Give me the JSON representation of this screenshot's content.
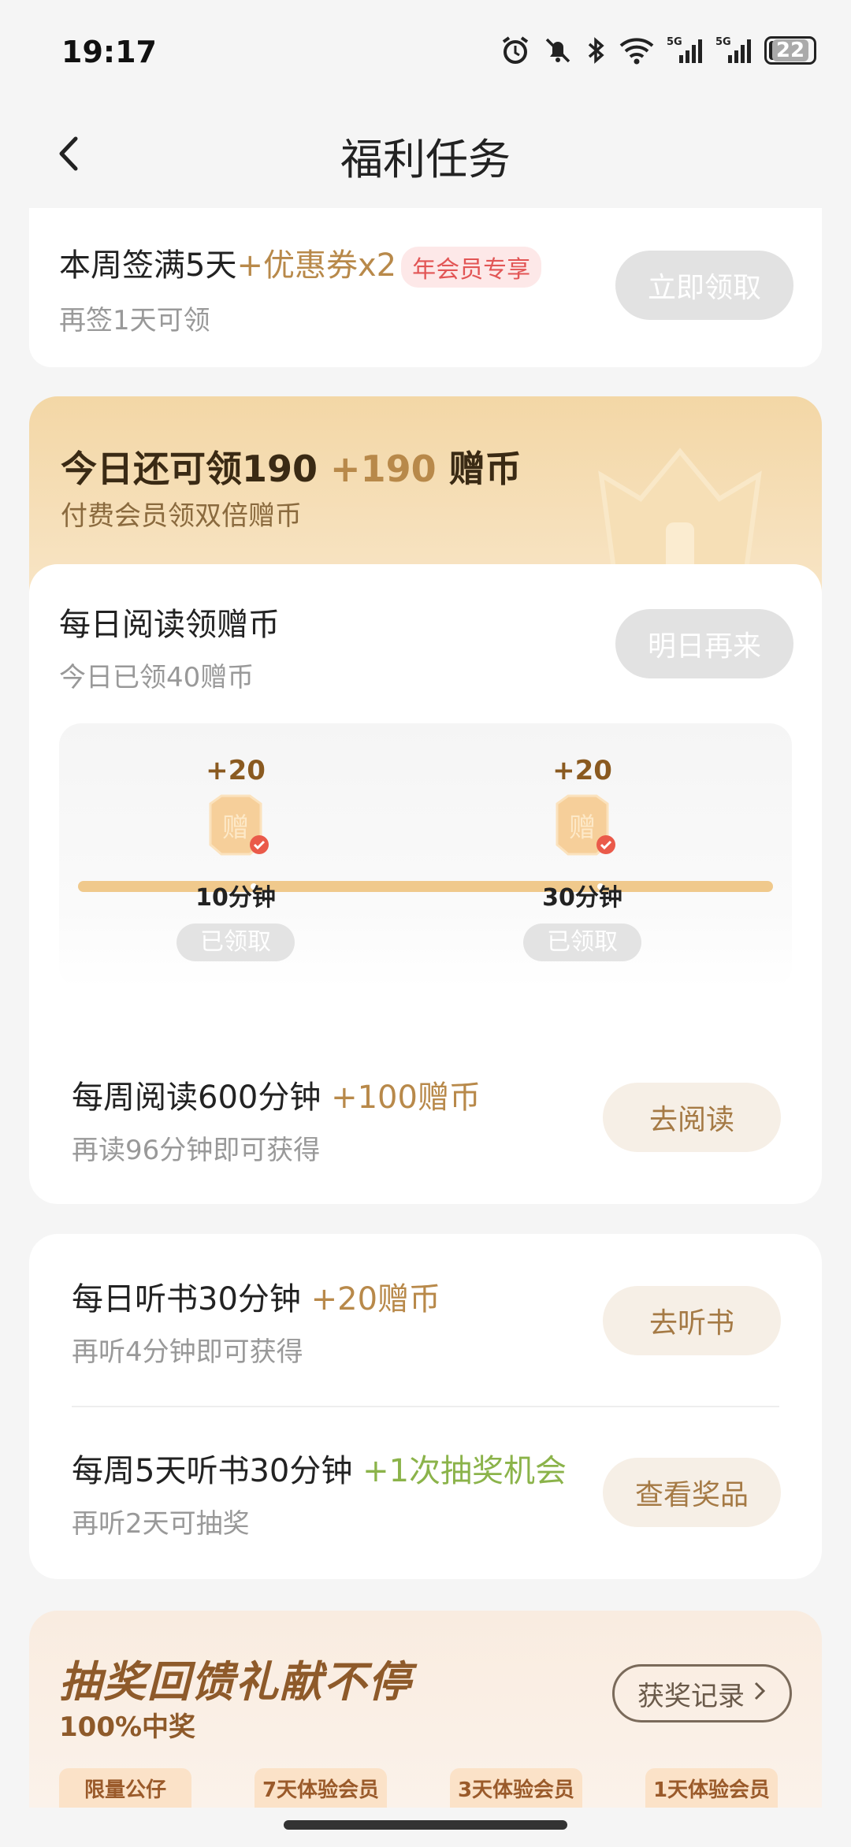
{
  "status": {
    "time": "19:17",
    "battery": "22"
  },
  "nav": {
    "title": "福利任务"
  },
  "signin": {
    "title": "本周签满5天",
    "reward": "+优惠券x2",
    "tag": "年会员专享",
    "sub": "再签1天可领",
    "button": "立即领取"
  },
  "coins_header": {
    "title_prefix": "今日还可领190",
    "title_plus": "+190",
    "title_suffix": "赠币",
    "sub": "付费会员领双倍赠币"
  },
  "daily_read": {
    "title": "每日阅读领赠币",
    "sub": "今日已领40赠币",
    "button": "明日再来",
    "milestones": [
      {
        "amount": "+20",
        "time": "10分钟",
        "status": "已领取"
      },
      {
        "amount": "+20",
        "time": "30分钟",
        "status": "已领取"
      }
    ]
  },
  "weekly_read": {
    "title": "每周阅读600分钟",
    "reward": "+100赠币",
    "sub": "再读96分钟即可获得",
    "button": "去阅读"
  },
  "daily_listen": {
    "title": "每日听书30分钟",
    "reward": "+20赠币",
    "sub": "再听4分钟即可获得",
    "button": "去听书"
  },
  "weekly_listen": {
    "title": "每周5天听书30分钟",
    "reward": "+1次抽奖机会",
    "sub": "再听2天可抽奖",
    "button": "查看奖品"
  },
  "lottery": {
    "title": "抽奖回馈礼献不停",
    "sub": "100%中奖",
    "record_button": "获奖记录",
    "prizes": [
      "限量公仔",
      "7天体验会员",
      "3天体验会员",
      "1天体验会员"
    ]
  },
  "colors": {
    "gold": "#b8894a",
    "accent_bg": "#f3d7a6",
    "green_reward": "#8bb34a"
  }
}
